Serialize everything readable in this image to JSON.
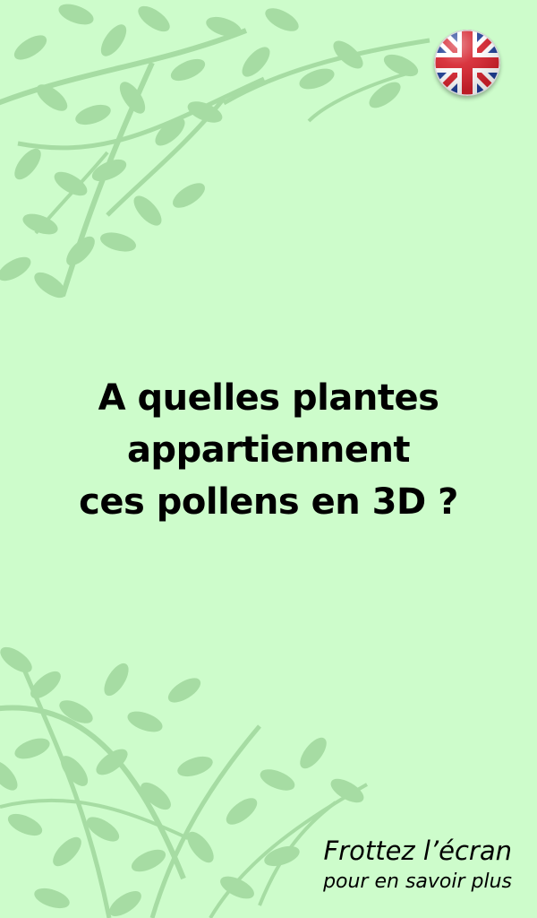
{
  "screen": {
    "background_color": "#cdfccb",
    "foliage_color": "#8fc98b"
  },
  "language_toggle": {
    "icon": "uk-flag-icon"
  },
  "headline": {
    "line_1": "A quelles plantes",
    "line_2": "appartiennent",
    "line_3": "ces pollens en 3D ?"
  },
  "hint": {
    "line_1": "Frottez l’écran",
    "line_2": "pour en savoir plus"
  }
}
